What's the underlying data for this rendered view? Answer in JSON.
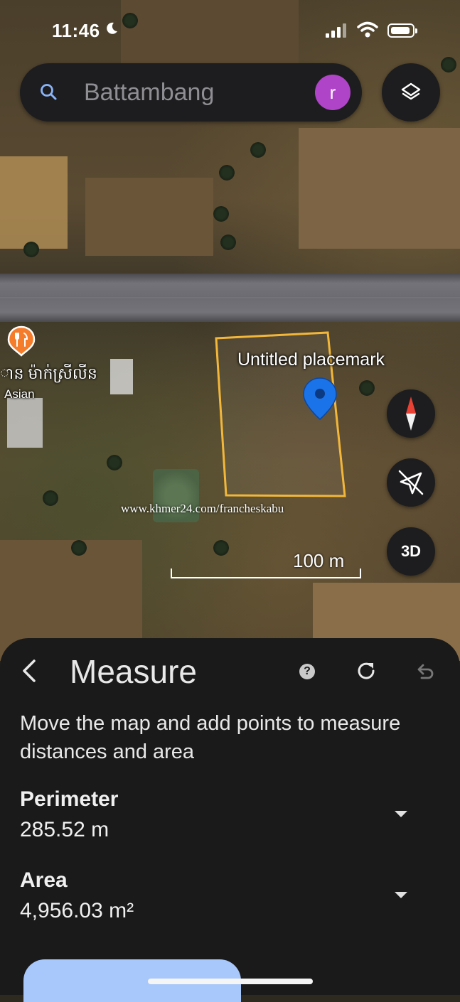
{
  "status_bar": {
    "time": "11:46"
  },
  "search": {
    "placeholder": "Battambang",
    "avatar_initial": "r"
  },
  "map": {
    "poi_label": "ាន ម៉ាក់ស្រីលីន",
    "poi_sub": "Asian",
    "placemark_label": "Untitled placemark",
    "watermark": "www.khmer24.com/francheskabu",
    "scale_label": "100 m",
    "three_d_label": "3D"
  },
  "panel": {
    "title": "Measure",
    "help_label": "?",
    "instructions": "Move the map and add points to measure distances and area",
    "perimeter_label": "Perimeter",
    "perimeter_value": "285.52 m",
    "area_label": "Area",
    "area_value": "4,956.03 m²"
  },
  "colors": {
    "placemark_outline": "#f2b73a",
    "pin_blue": "#1a73e8",
    "avatar_purple": "#b044c9",
    "poi_orange": "#f57c2a",
    "compass_red": "#e94235",
    "primary_button": "#a8c7fa"
  },
  "icons": {
    "search": "search-icon",
    "layers": "layers-icon",
    "compass": "compass-icon",
    "location_off": "location-off-icon",
    "back": "chevron-left-icon",
    "help": "help-icon",
    "refresh": "refresh-icon",
    "undo": "undo-icon",
    "dropdown": "caret-down-icon"
  }
}
